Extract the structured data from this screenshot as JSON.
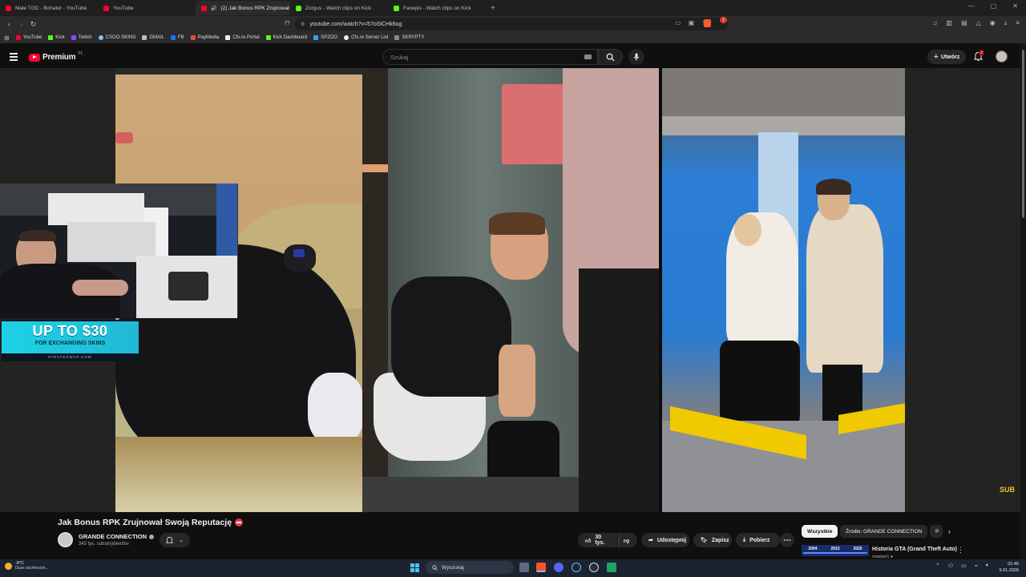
{
  "browser": {
    "tabs": [
      {
        "title": "Małe TGD - Bohater - YouTube",
        "favicon": "youtube-icon",
        "active": false
      },
      {
        "title": "YouTube",
        "favicon": "youtube-icon",
        "active": false
      },
      {
        "title": "(2) Jak Bonus RPK Zrujnował",
        "favicon": "youtube-icon",
        "active": true
      },
      {
        "title": "Zorgus - Watch clips on Kick",
        "favicon": "kick-icon",
        "active": false
      },
      {
        "title": "Facepis - Watch clips on Kick",
        "favicon": "kick-icon",
        "active": false
      }
    ],
    "new_tab": "+",
    "url": "youtube.com/watch?v=57oSiCHk6ug",
    "brave_shield_count": "1",
    "bookmarks": [
      {
        "label": "YouTube",
        "color": "#ff0033"
      },
      {
        "label": "Kick",
        "color": "#53fc18"
      },
      {
        "label": "Twitch",
        "color": "#9146ff"
      },
      {
        "label": "CSGO-SKINS",
        "color": "#7dc3ff"
      },
      {
        "label": "GMAIL",
        "color": "#bbbbbb"
      },
      {
        "label": "FB",
        "color": "#1877f2"
      },
      {
        "label": "PayMedia",
        "color": "#e74c3c"
      },
      {
        "label": "Cfx.re Portal",
        "color": "#f0f0f0"
      },
      {
        "label": "Kick Dashboard",
        "color": "#53fc18"
      },
      {
        "label": "SPZOO",
        "color": "#3aa3e3"
      },
      {
        "label": "Cfx.re Server List",
        "color": "#f0f0f0"
      },
      {
        "label": "SKRYPTY",
        "color": "#888888"
      }
    ]
  },
  "youtube": {
    "logo_text": "Premium",
    "logo_region": "PL",
    "search_placeholder": "Szukaj",
    "create_label": "Utwórz",
    "notifications_count": "2",
    "video": {
      "title": "Jak Bonus RPK Zrujnował Swoją Reputację",
      "channel": "GRANDE CONNECTION",
      "subscribers": "343 tys. subskrybentów",
      "likes": "30 tys.",
      "share_label": "Udostępnij",
      "save_label": "Zapisz",
      "download_label": "Pobierz",
      "more_label": "⋯",
      "sub_badge": "SUB"
    },
    "overlay_ad": {
      "headline": "UP TO $30",
      "subline": "FOR EXCHANGING SKINS",
      "brand": "PIRATESWAP.COM"
    },
    "chips": [
      "Wszystkie",
      "Źródło: GRANDE CONNECTION",
      "P"
    ],
    "recommendation": {
      "thumb_years": [
        "2004",
        "2013",
        "2025"
      ],
      "title": "Historia GTA (Grand Theft Auto)",
      "meta": "madam1 ●"
    }
  },
  "taskbar": {
    "weather_temp": "-8°C",
    "weather_desc": "Duże zachmurze...",
    "search_label": "Wyszukaj",
    "time": "01:45",
    "date": "9.01.2026"
  }
}
